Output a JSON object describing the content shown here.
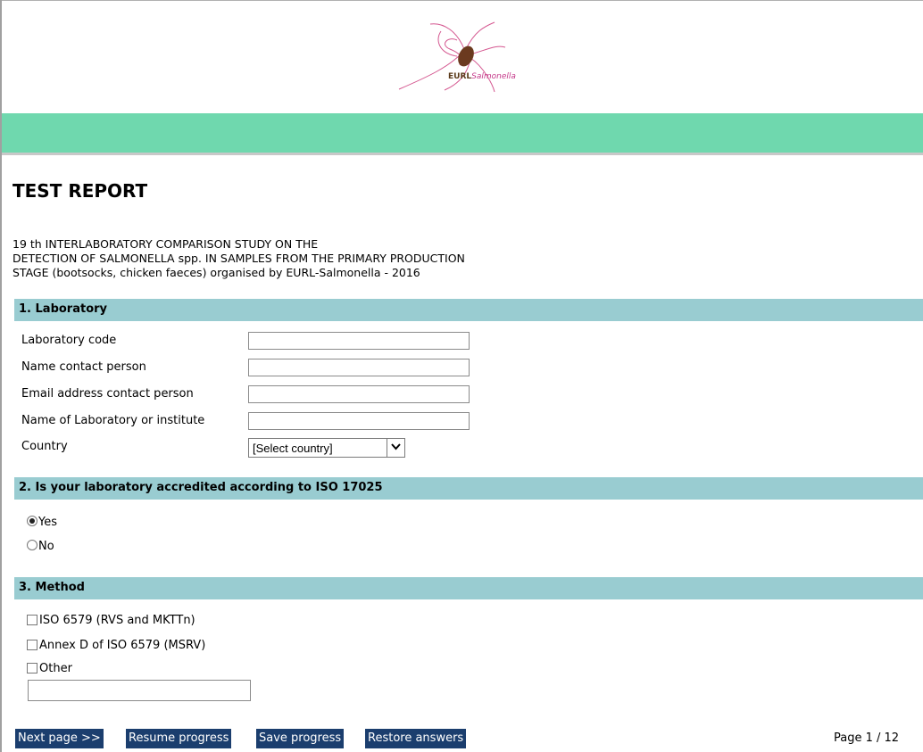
{
  "header": {
    "logo": {
      "brand_bold": "EURL",
      "brand_italic": "Salmonella",
      "icon": "salmonella-logo-icon"
    },
    "band_color": "#6fd8ae"
  },
  "title": "TEST REPORT",
  "intro": [
    "19 th INTERLABORATORY COMPARISON STUDY ON THE",
    "DETECTION OF SALMONELLA spp. IN SAMPLES FROM THE PRIMARY PRODUCTION",
    "STAGE (bootsocks, chicken faeces) organised by EURL-Salmonella - 2016"
  ],
  "sections": {
    "laboratory": {
      "heading": "1. Laboratory",
      "fields": [
        {
          "label": "Laboratory code",
          "value": ""
        },
        {
          "label": "Name contact person",
          "value": ""
        },
        {
          "label": "Email address contact person",
          "value": ""
        },
        {
          "label": "Name of Laboratory or institute",
          "value": ""
        }
      ],
      "country": {
        "label": "Country",
        "selected": "[Select country]"
      }
    },
    "accredited": {
      "heading": "2. Is your laboratory accredited according to ISO 17025",
      "options": [
        {
          "label": "Yes",
          "selected": true
        },
        {
          "label": "No",
          "selected": false
        }
      ]
    },
    "method": {
      "heading": "3. Method",
      "options": [
        {
          "label": "ISO 6579 (RVS and MKTTn)",
          "checked": false
        },
        {
          "label": "Annex D of ISO 6579 (MSRV)",
          "checked": false
        },
        {
          "label": "Other",
          "checked": false
        }
      ],
      "other_value": ""
    }
  },
  "buttons": {
    "next": "Next page >>",
    "resume": "Resume progress",
    "save": "Save progress",
    "restore": "Restore answers"
  },
  "page_indicator": "Page 1 / 12",
  "colors": {
    "section_bg": "#99ccd1",
    "button_bg": "#1b3e6e"
  }
}
